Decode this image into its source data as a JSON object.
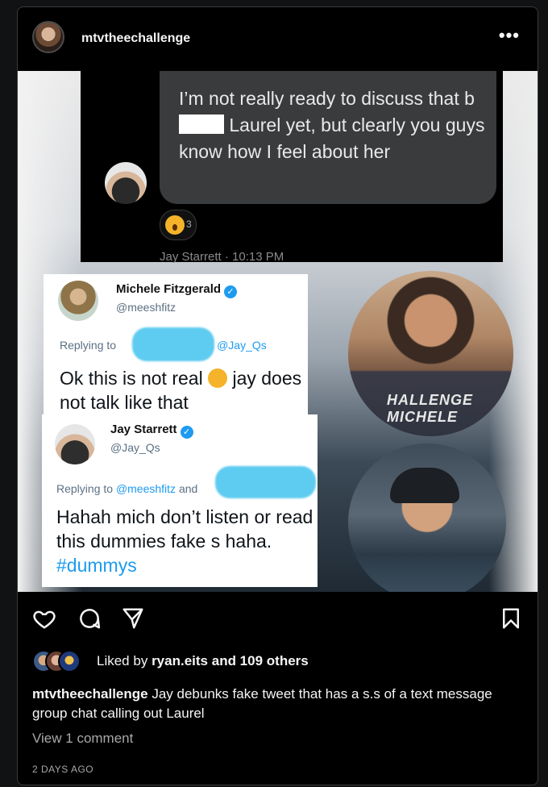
{
  "post": {
    "username": "mtvtheechallenge",
    "more_label": "•••",
    "dm": {
      "text_before": "I’m not really ready to discuss that b",
      "text_after": " Laurel yet, but clearly you guys know how I feel about her",
      "reaction_count": "3",
      "meta": "Jay Starrett · 10:13 PM"
    },
    "tweet1": {
      "name": "Michele Fitzgerald",
      "handle": "@meeshfitz",
      "replying_prefix": "Replying to",
      "replying_suffix": "and @Jay_Qs",
      "body_before": "Ok this is not real",
      "body_after": " jay does not talk like that"
    },
    "tweet2": {
      "name": "Jay Starrett",
      "handle": "@Jay_Qs",
      "replying_prefix": "Replying to",
      "replying_mention": "@meeshfitz",
      "replying_suffix": " and",
      "body": "Hahah mich don’t listen or read this dummies fake s haha.",
      "hashtag": "#dummys"
    },
    "photo_text": "HALLENGE MICHELE"
  },
  "actions": {
    "like_icon": "heart-icon",
    "comment_icon": "comment-icon",
    "share_icon": "send-icon",
    "save_icon": "bookmark-icon"
  },
  "likes": {
    "prefix": "Liked by",
    "user": "ryan.eits",
    "suffix": "and 109 others"
  },
  "caption": {
    "user": "mtvtheechallenge",
    "text": "Jay debunks fake tweet that has a s.s of a text message group chat calling out Laurel"
  },
  "comments_link": "View 1 comment",
  "timestamp": "2 DAYS AGO",
  "colors": {
    "background": "#000000",
    "text": "#f5f5f5",
    "muted": "#a8a8a8",
    "twitter_blue": "#1d9bf0"
  }
}
